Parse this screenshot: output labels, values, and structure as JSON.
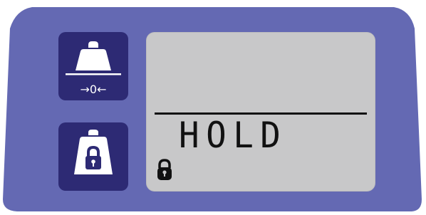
{
  "device": {
    "colors": {
      "panel": "#6469b3",
      "button": "#2d2a74",
      "screen": "#c8c8c9",
      "lcd_text": "#111111"
    },
    "buttons": [
      {
        "name": "tare-zero-button",
        "label": "→0←",
        "icon": "weight-icon"
      },
      {
        "name": "hold-button",
        "icon": "weight-lock-icon"
      }
    ],
    "display": {
      "mode_text": "HOLD",
      "lock_icon": "lock-icon"
    }
  }
}
